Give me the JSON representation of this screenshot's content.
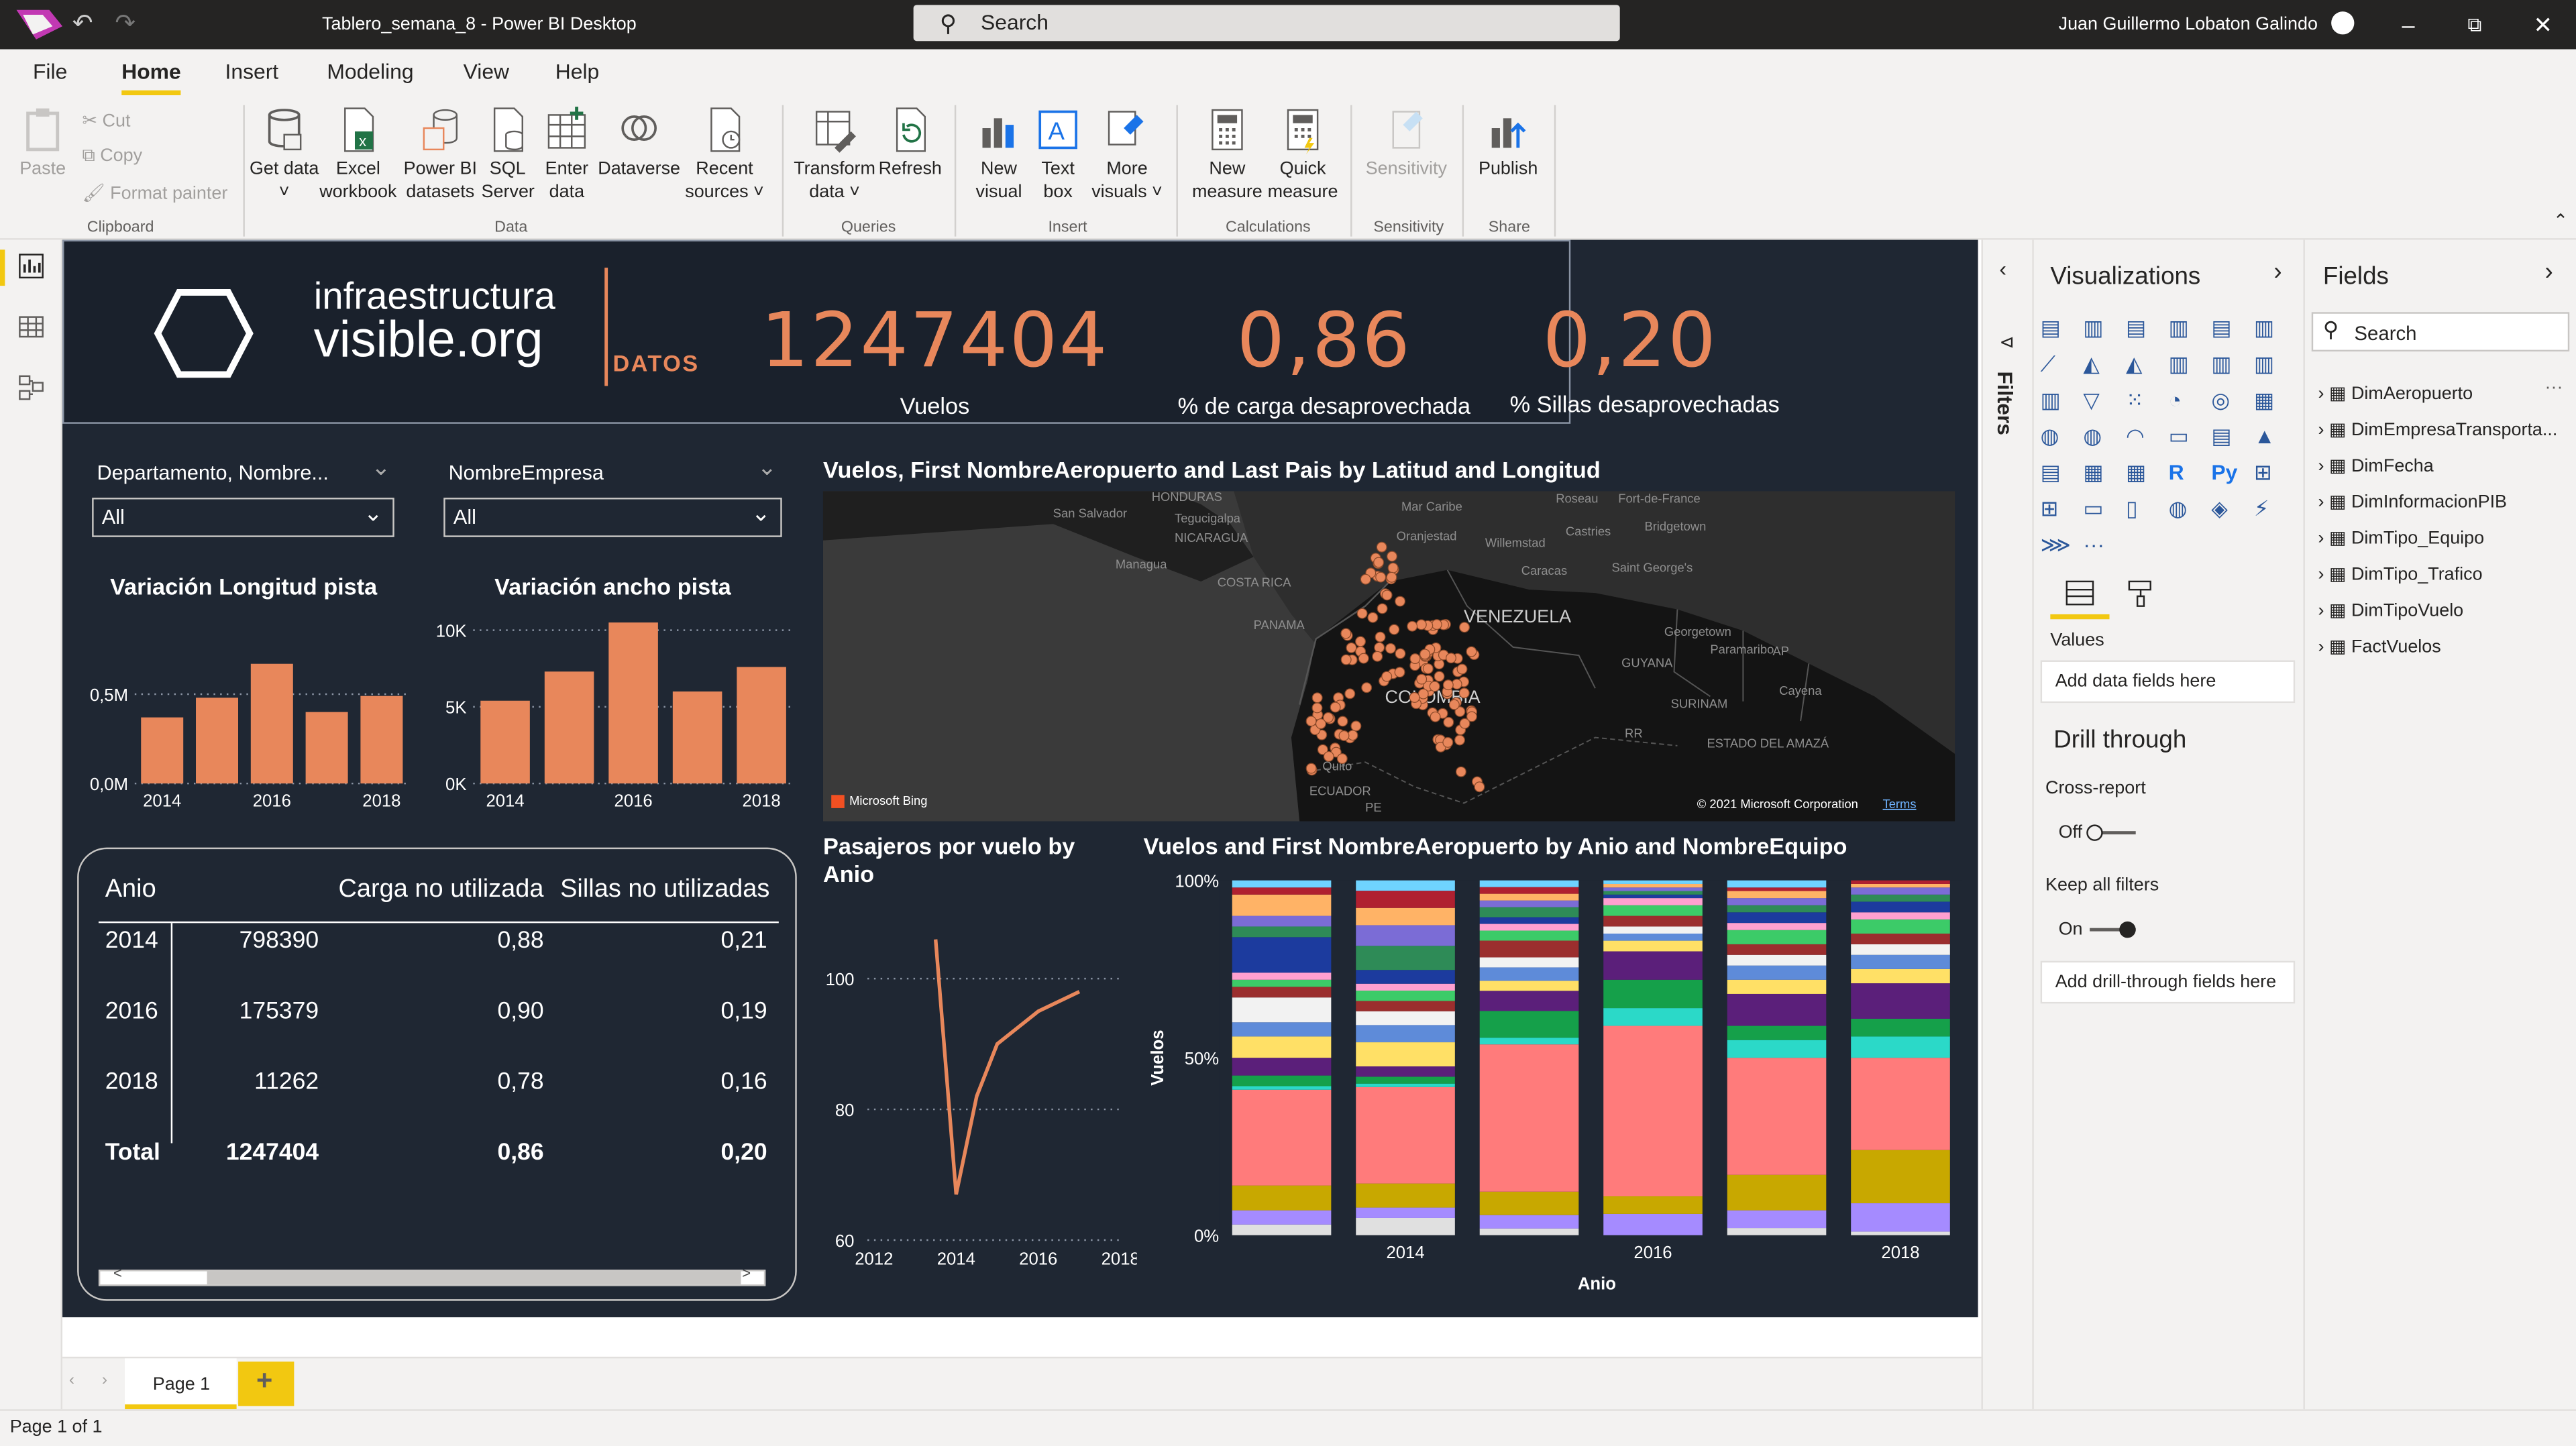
{
  "window": {
    "title": "Tablero_semana_8 - Power BI Desktop",
    "search_placeholder": "Search",
    "user": "Juan Guillermo Lobaton Galindo"
  },
  "menu": [
    "File",
    "Home",
    "Insert",
    "Modeling",
    "View",
    "Help"
  ],
  "ribbon": {
    "clipboard": {
      "paste": "Paste",
      "cut": "Cut",
      "copy": "Copy",
      "format_painter": "Format painter",
      "group": "Clipboard"
    },
    "data": {
      "get_data": "Get data ˅",
      "excel": "Excel workbook",
      "pbi": "Power BI datasets",
      "sql": "SQL Server",
      "enter": "Enter data",
      "dataverse": "Dataverse",
      "recent": "Recent sources ˅",
      "group": "Data"
    },
    "queries": {
      "transform": "Transform data ˅",
      "refresh": "Refresh",
      "group": "Queries"
    },
    "insert": {
      "new_visual": "New visual",
      "text_box": "Text box",
      "more_visuals": "More visuals ˅",
      "group": "Insert"
    },
    "calculations": {
      "new_measure": "New measure",
      "quick_measure": "Quick measure",
      "group": "Calculations"
    },
    "sensitivity": {
      "sensitivity": "Sensitivity",
      "group": "Sensitivity"
    },
    "share": {
      "publish": "Publish",
      "group": "Share"
    }
  },
  "report": {
    "logo": {
      "line1": "infraestructura",
      "line2": "visible.org",
      "tag": "DATOS"
    },
    "kpis": [
      {
        "value": "1247404",
        "label": "Vuelos"
      },
      {
        "value": "0,86",
        "label": "% de carga desaprovechada"
      },
      {
        "value": "0,20",
        "label": "% Sillas desaprovechadas"
      }
    ],
    "slicers": [
      {
        "label": "Departamento, Nombre...",
        "value": "All"
      },
      {
        "label": "NombreEmpresa",
        "value": "All"
      }
    ],
    "map": {
      "title": "Vuelos, First NombreAeropuerto and Last Pais by Latitud and Longitud",
      "labels": [
        "HONDURAS",
        "San Salvador",
        "Tegucigalpa",
        "NICARAGUA",
        "Managua",
        "COSTA RICA",
        "PANAMA",
        "Mar Caribe",
        "Oranjestad",
        "Willemstad",
        "Roseau",
        "Fort-de-France",
        "Castries",
        "Bridgetown",
        "Caracas",
        "Saint George's",
        "VENEZUELA",
        "Georgetown",
        "GUYANA",
        "Paramaribo",
        "Cayena",
        "SURINAM",
        "COLOMBIA",
        "Quito",
        "ECUADOR",
        "ESTADO DEL AMAZÁ",
        "PE",
        "RR",
        "AP"
      ],
      "bing": "Microsoft Bing",
      "copyright": "© 2021 Microsoft Corporation",
      "terms": "Terms"
    },
    "bar_long": {
      "title": "Variación Longitud pista"
    },
    "bar_ancho": {
      "title": "Variación ancho pista"
    },
    "table": {
      "headers": [
        "Anio",
        "Carga no utilizada",
        "Sillas no utilizadas"
      ],
      "rows": [
        [
          "2014",
          "798390",
          "0,88",
          "0,21"
        ],
        [
          "2016",
          "175379",
          "0,90",
          "0,19"
        ],
        [
          "2018",
          "11262",
          "0,78",
          "0,16"
        ]
      ],
      "total": [
        "Total",
        "1247404",
        "0,86",
        "0,20"
      ]
    },
    "line": {
      "title_line1": "Pasajeros por vuelo by",
      "title_line2": "Anio"
    },
    "stacked": {
      "title": "Vuelos and First NombreAeropuerto by Anio and NombreEquipo",
      "ylabel": "Vuelos",
      "xlabel": "Anio"
    }
  },
  "chart_data": [
    {
      "type": "bar",
      "title": "Variación Longitud pista",
      "categories": [
        "2014",
        "2015",
        "2016",
        "2017",
        "2018"
      ],
      "x_ticks": [
        "2014",
        "2016",
        "2018"
      ],
      "values": [
        0.37,
        0.48,
        0.67,
        0.4,
        0.49
      ],
      "unit": "M",
      "y_ticks": [
        "0,0M",
        "0,5M"
      ],
      "ylim": [
        0,
        0.8
      ]
    },
    {
      "type": "bar",
      "title": "Variación ancho pista",
      "categories": [
        "2014",
        "2015",
        "2016",
        "2017",
        "2018"
      ],
      "x_ticks": [
        "2014",
        "2016",
        "2018"
      ],
      "values": [
        5400,
        7300,
        10500,
        6000,
        7600
      ],
      "y_ticks": [
        "0K",
        "5K",
        "10K"
      ],
      "ylim": [
        0,
        10500
      ]
    },
    {
      "type": "line",
      "title": "Pasajeros por vuelo by Anio",
      "x": [
        2013.5,
        2014,
        2014.5,
        2015,
        2016,
        2017
      ],
      "x_ticks": [
        "2012",
        "2014",
        "2016",
        "2018"
      ],
      "y": [
        106,
        67,
        82,
        90,
        95,
        98
      ],
      "y_ticks": [
        "60",
        "80",
        "100"
      ],
      "ylim": [
        60,
        110
      ]
    },
    {
      "type": "bar",
      "stacked": true,
      "percent": true,
      "title": "Vuelos and First NombreAeropuerto by Anio and NombreEquipo",
      "categories": [
        "2013",
        "2014",
        "2015",
        "2016",
        "2017",
        "2018"
      ],
      "x_ticks": [
        "2014",
        "2016",
        "2018"
      ],
      "y_ticks": [
        "0%",
        "50%",
        "100%"
      ]
    }
  ],
  "panes": {
    "filters": "Filters",
    "visualizations": {
      "title": "Visualizations",
      "values": "Values",
      "add_fields": "Add data fields here",
      "drill": "Drill through",
      "cross": "Cross-report",
      "off": "Off",
      "keep": "Keep all filters",
      "on": "On",
      "add_drill": "Add drill-through fields here"
    },
    "fields": {
      "title": "Fields",
      "search": "Search",
      "tables": [
        "DimAeropuerto",
        "DimEmpresaTransporta...",
        "DimFecha",
        "DimInformacionPIB",
        "DimTipo_Equipo",
        "DimTipo_Trafico",
        "DimTipoVuelo",
        "FactVuelos"
      ]
    }
  },
  "pages": {
    "tab": "Page 1",
    "status": "Page 1 of 1"
  },
  "colors": {
    "accent": "#e8875b",
    "report_bg": "#1f2733",
    "header_bg": "#1a212c",
    "bar": "#e8875b"
  }
}
